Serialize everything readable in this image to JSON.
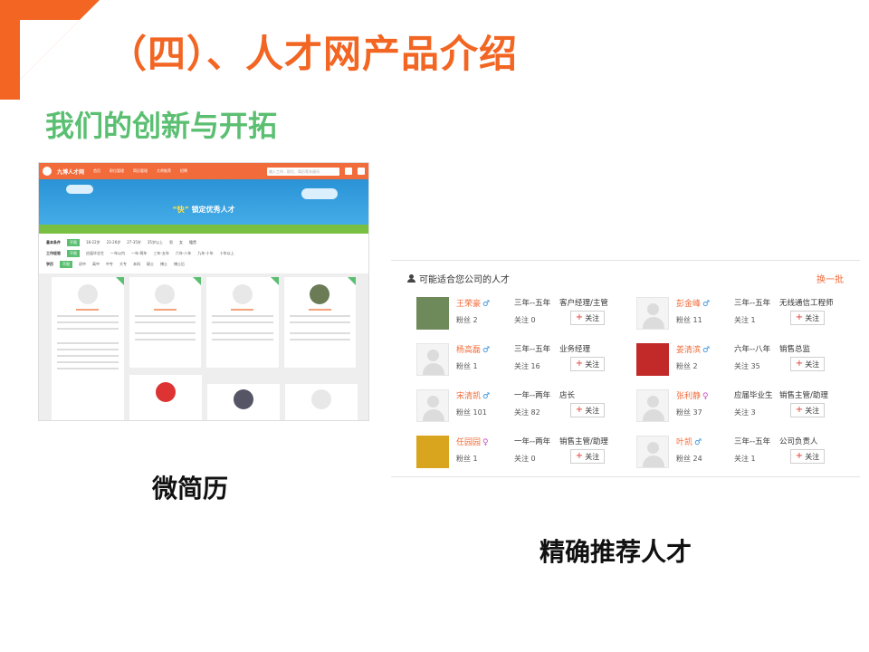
{
  "title": "（四）、人才网产品介绍",
  "subtitle": "我们的创新与开拓",
  "brand_color": "#f26522",
  "accent_green": "#5bbf72",
  "captions": {
    "micro_resume": "微简历",
    "precise": "精确推荐人才"
  },
  "left_shot": {
    "brand": "九博人才网",
    "nav": [
      "首页",
      "职位管理",
      "简历管理",
      "大师推荐",
      "招聘"
    ],
    "search_placeholder": "输入工作、职位、简历等关键词",
    "slogan_quote": "“快”",
    "slogan_rest": "锁定优秀人才",
    "filters": [
      {
        "label": "基本条件",
        "options": [
          "不限",
          "18-22岁",
          "23-26岁",
          "27-35岁",
          "35岁以上",
          "男",
          "女",
          "籍贯"
        ]
      },
      {
        "label": "工作经验",
        "options": [
          "不限",
          "应届毕业生",
          "一年以内",
          "一年-两年",
          "三年-五年",
          "六年-八年",
          "九年-十年",
          "十年以上"
        ]
      },
      {
        "label": "学历",
        "options": [
          "不限",
          "初中",
          "高中",
          "中专",
          "大专",
          "本科",
          "硕士",
          "博士",
          "博士后"
        ]
      }
    ]
  },
  "right_shot": {
    "header": "可能适合您公司的人才",
    "refresh": "换一批",
    "follow_label": "关注",
    "candidates": [
      {
        "name": "王荣豪",
        "gender": "male",
        "fans": "粉丝 2",
        "exp": "三年--五年",
        "position": "客户经理/主管",
        "follow": "关注 0",
        "photo": "#6f8a5a"
      },
      {
        "name": "彭金峰",
        "gender": "male",
        "fans": "粉丝 11",
        "exp": "三年--五年",
        "position": "无线通信工程师",
        "follow": "关注 1",
        "photo": ""
      },
      {
        "name": "杨高磊",
        "gender": "male",
        "fans": "粉丝 1",
        "exp": "三年--五年",
        "position": "业务经理",
        "follow": "关注 16",
        "photo": ""
      },
      {
        "name": "姜清滨",
        "gender": "male",
        "fans": "粉丝 2",
        "exp": "六年--八年",
        "position": "销售总监",
        "follow": "关注 35",
        "photo": "#c22a2a"
      },
      {
        "name": "宋清凯",
        "gender": "male",
        "fans": "粉丝 101",
        "exp": "一年--两年",
        "position": "店长",
        "follow": "关注 82",
        "photo": ""
      },
      {
        "name": "张利静",
        "gender": "female",
        "fans": "粉丝 37",
        "exp": "应届毕业生",
        "position": "销售主管/助理",
        "follow": "关注 3",
        "photo": ""
      },
      {
        "name": "任园园",
        "gender": "female",
        "fans": "粉丝 1",
        "exp": "一年--两年",
        "position": "销售主管/助理",
        "follow": "关注 0",
        "photo": "#d9a51e"
      },
      {
        "name": "叶凯",
        "gender": "male",
        "fans": "粉丝 24",
        "exp": "三年--五年",
        "position": "公司负责人",
        "follow": "关注 1",
        "photo": ""
      }
    ]
  }
}
